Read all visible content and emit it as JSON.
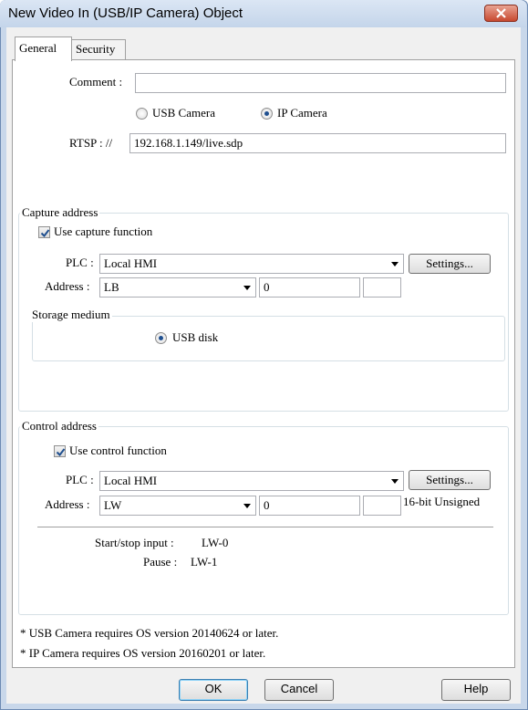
{
  "window": {
    "title": "New Video In (USB/IP Camera) Object"
  },
  "tabs": [
    {
      "label": "General",
      "active": true
    },
    {
      "label": "Security",
      "active": false
    }
  ],
  "general": {
    "comment_label": "Comment :",
    "comment_value": "",
    "camera_type": {
      "options": [
        "USB Camera",
        "IP Camera"
      ],
      "selected": "IP Camera"
    },
    "rtsp_label": "RTSP : //",
    "rtsp_value": "192.168.1.149/live.sdp"
  },
  "capture_address": {
    "group_title": "Capture address",
    "use_function_label": "Use capture function",
    "use_function_checked": true,
    "plc_label": "PLC :",
    "plc_value": "Local HMI",
    "settings_label": "Settings...",
    "address_label": "Address :",
    "address_device": "LB",
    "address_value": "0",
    "address_extra": "",
    "storage": {
      "group_title": "Storage medium",
      "option_label": "USB disk",
      "selected": true
    }
  },
  "control_address": {
    "group_title": "Control address",
    "use_function_label": "Use control function",
    "use_function_checked": true,
    "plc_label": "PLC :",
    "plc_value": "Local HMI",
    "settings_label": "Settings...",
    "address_label": "Address :",
    "address_device": "LW",
    "address_value": "0",
    "address_extra": "",
    "data_format": "16-bit Unsigned",
    "start_stop_label": "Start/stop input :",
    "start_stop_value": "LW-0",
    "pause_label": "Pause :",
    "pause_value": "LW-1"
  },
  "notes": [
    "* USB Camera requires OS version 20140624 or later.",
    "* IP Camera requires OS version 20160201 or later."
  ],
  "buttons": {
    "ok": "OK",
    "cancel": "Cancel",
    "help": "Help"
  },
  "colors": {
    "title_bar": "#c4d5ea",
    "close_button": "#c8492f",
    "radio_dot": "#1f4f8f",
    "check_mark": "#1f4f8f"
  }
}
